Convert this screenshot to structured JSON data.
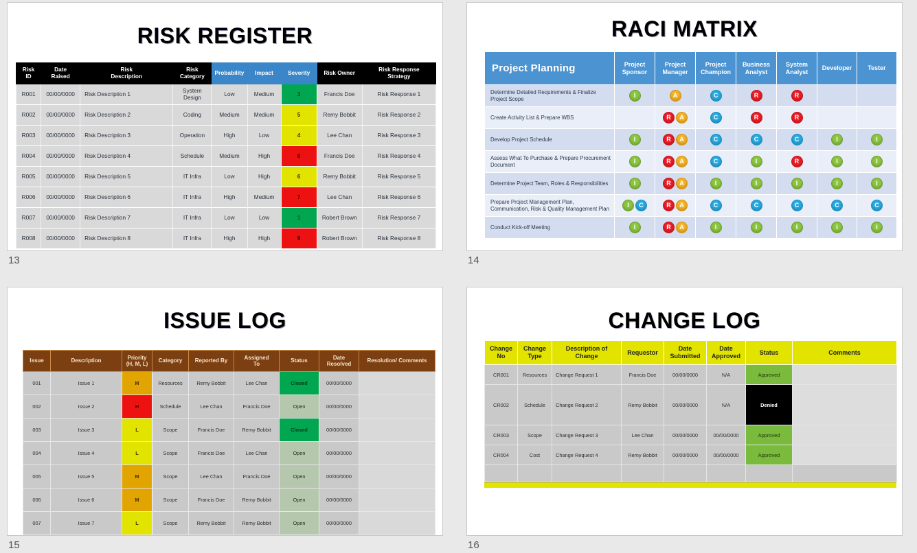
{
  "slides": [
    {
      "number": "13",
      "title": "RISK REGISTER",
      "table": {
        "headers": [
          {
            "label": "Risk ID",
            "lines": [
              "Risk",
              "ID"
            ],
            "style": "black"
          },
          {
            "label": "Date Raised",
            "lines": [
              "Date",
              "Raised"
            ],
            "style": "black"
          },
          {
            "label": "Risk Description",
            "lines": [
              "Risk",
              "Description"
            ],
            "style": "black"
          },
          {
            "label": "Risk Category",
            "lines": [
              "Risk",
              "Category"
            ],
            "style": "black"
          },
          {
            "label": "Probability",
            "lines": [
              "Probability"
            ],
            "style": "blue"
          },
          {
            "label": "Impact",
            "lines": [
              "Impact"
            ],
            "style": "blue"
          },
          {
            "label": "Severity",
            "lines": [
              "Severity"
            ],
            "style": "blue"
          },
          {
            "label": "Risk Owner",
            "lines": [
              "Risk Owner"
            ],
            "style": "black"
          },
          {
            "label": "Risk Response Strategy",
            "lines": [
              "Risk Response",
              "Strategy"
            ],
            "style": "black"
          }
        ],
        "rows": [
          {
            "id": "R001",
            "date": "00/00/0000",
            "description": "Risk Description 1",
            "category": "System Design",
            "probability": "Low",
            "impact": "Medium",
            "severity": "3",
            "severity_color": "g",
            "owner": "Francis Doe",
            "response": "Risk Response 1"
          },
          {
            "id": "R002",
            "date": "00/00/0000",
            "description": "Risk Description 2",
            "category": "Coding",
            "probability": "Medium",
            "impact": "Medium",
            "severity": "5",
            "severity_color": "y",
            "owner": "Remy Bobbit",
            "response": "Risk Response 2"
          },
          {
            "id": "R003",
            "date": "00/00/0000",
            "description": "Risk Description 3",
            "category": "Operation",
            "probability": "High",
            "impact": "Low",
            "severity": "4",
            "severity_color": "y",
            "owner": "Lee Chan",
            "response": "Risk Response 3"
          },
          {
            "id": "R004",
            "date": "00/00/0000",
            "description": "Risk Description 4",
            "category": "Schedule",
            "probability": "Medium",
            "impact": "High",
            "severity": "8",
            "severity_color": "r",
            "owner": "Francis Doe",
            "response": "Risk Response 4"
          },
          {
            "id": "R005",
            "date": "00/00/0000",
            "description": "Risk Description 5",
            "category": "IT Infra",
            "probability": "Low",
            "impact": "High",
            "severity": "6",
            "severity_color": "y",
            "owner": "Remy Bobbit",
            "response": "Risk Response 5"
          },
          {
            "id": "R006",
            "date": "00/00/0000",
            "description": "Risk Description 6",
            "category": "IT Infra",
            "probability": "High",
            "impact": "Medium",
            "severity": "7",
            "severity_color": "r",
            "owner": "Lee Chan",
            "response": "Risk Response 6"
          },
          {
            "id": "R007",
            "date": "00/00/0000",
            "description": "Risk Description 7",
            "category": "IT Infra",
            "probability": "Low",
            "impact": "Low",
            "severity": "1",
            "severity_color": "g",
            "owner": "Robert Brown",
            "response": "Risk Response 7"
          },
          {
            "id": "R008",
            "date": "00/00/0000",
            "description": "Risk Description 8",
            "category": "IT Infra",
            "probability": "High",
            "impact": "High",
            "severity": "9",
            "severity_color": "r",
            "owner": "Robert Brown",
            "response": "Risk Response 8"
          }
        ]
      }
    },
    {
      "number": "14",
      "title": "RACI MATRIX",
      "table": {
        "section_label": "Project Planning",
        "roles": [
          "Project Sponsor",
          "Project Manager",
          "Project Champion",
          "Business Analyst",
          "System Analyst",
          "Developer",
          "Tester"
        ],
        "role_lines": [
          [
            "Project",
            "Sponsor"
          ],
          [
            "Project",
            "Manager"
          ],
          [
            "Project",
            "Champion"
          ],
          [
            "Business",
            "Analyst"
          ],
          [
            "System",
            "Analyst"
          ],
          [
            "Developer"
          ],
          [
            "Tester"
          ]
        ],
        "rows": [
          {
            "task": "Determine Detailed Requirements & Finalize Project Scope",
            "cells": [
              [
                "I"
              ],
              [
                "A"
              ],
              [
                "C"
              ],
              [
                "R"
              ],
              [
                "R"
              ],
              [],
              []
            ]
          },
          {
            "task": "Create Activity List & Prepare WBS",
            "cells": [
              [],
              [
                "R",
                "A"
              ],
              [
                "C"
              ],
              [
                "R"
              ],
              [
                "R"
              ],
              [],
              []
            ]
          },
          {
            "task": "Develop Project Schedule",
            "cells": [
              [
                "I"
              ],
              [
                "R",
                "A"
              ],
              [
                "C"
              ],
              [
                "C"
              ],
              [
                "C"
              ],
              [
                "I"
              ],
              [
                "I"
              ]
            ]
          },
          {
            "task": "Assess What To Purchase & Prepare Procurement Document",
            "cells": [
              [
                "I"
              ],
              [
                "R",
                "A"
              ],
              [
                "C"
              ],
              [
                "I"
              ],
              [
                "R"
              ],
              [
                "I"
              ],
              [
                "I"
              ]
            ]
          },
          {
            "task": "Determine Project Team, Roles & Responsibilities",
            "cells": [
              [
                "I"
              ],
              [
                "R",
                "A"
              ],
              [
                "I"
              ],
              [
                "I"
              ],
              [
                "I"
              ],
              [
                "I"
              ],
              [
                "I"
              ]
            ]
          },
          {
            "task": "Prepare Project Management Plan, Communication, Risk & Quality Management Plan",
            "cells": [
              [
                "I",
                "C"
              ],
              [
                "R",
                "A"
              ],
              [
                "C"
              ],
              [
                "C"
              ],
              [
                "C"
              ],
              [
                "C"
              ],
              [
                "C"
              ]
            ]
          },
          {
            "task": "Conduct Kick-off Meeting",
            "cells": [
              [
                "I"
              ],
              [
                "R",
                "A"
              ],
              [
                "I"
              ],
              [
                "I"
              ],
              [
                "I"
              ],
              [
                "I"
              ],
              [
                "I"
              ]
            ]
          }
        ]
      }
    },
    {
      "number": "15",
      "title": "ISSUE LOG",
      "table": {
        "headers": [
          {
            "lines": [
              "Issue"
            ]
          },
          {
            "lines": [
              "Description"
            ]
          },
          {
            "lines": [
              "Priority",
              "(H, M, L)"
            ]
          },
          {
            "lines": [
              "Category"
            ]
          },
          {
            "lines": [
              "Reported By"
            ]
          },
          {
            "lines": [
              "Assigned",
              "To"
            ]
          },
          {
            "lines": [
              "Status"
            ]
          },
          {
            "lines": [
              "Date",
              "Resolved"
            ]
          },
          {
            "lines": [
              "Resolution/ Comments"
            ]
          }
        ],
        "rows": [
          {
            "issue": "001",
            "description": "Issue 1",
            "priority": "M",
            "category": "Resources",
            "reported_by": "Remy Bobbit",
            "assigned_to": "Lee Chan",
            "status": "Closed",
            "date_resolved": "00/00/0000",
            "resolution": ""
          },
          {
            "issue": "002",
            "description": "Issue 2",
            "priority": "H",
            "category": "Schedule",
            "reported_by": "Lee Chan",
            "assigned_to": "Francis Doe",
            "status": "Open",
            "date_resolved": "00/00/0000",
            "resolution": ""
          },
          {
            "issue": "003",
            "description": "Issue 3",
            "priority": "L",
            "category": "Scope",
            "reported_by": "Francis Doe",
            "assigned_to": "Remy Bobbit",
            "status": "Closed",
            "date_resolved": "00/00/0000",
            "resolution": ""
          },
          {
            "issue": "004",
            "description": "Issue 4",
            "priority": "L",
            "category": "Scope",
            "reported_by": "Francis Doe",
            "assigned_to": "Lee Chan",
            "status": "Open",
            "date_resolved": "00/00/0000",
            "resolution": ""
          },
          {
            "issue": "005",
            "description": "Issue 5",
            "priority": "M",
            "category": "Scope",
            "reported_by": "Lee Chan",
            "assigned_to": "Francis Doe",
            "status": "Open",
            "date_resolved": "00/00/0000",
            "resolution": ""
          },
          {
            "issue": "006",
            "description": "Issue 6",
            "priority": "M",
            "category": "Scope",
            "reported_by": "Francis Doe",
            "assigned_to": "Remy Bobbit",
            "status": "Open",
            "date_resolved": "00/00/0000",
            "resolution": ""
          },
          {
            "issue": "007",
            "description": "Issue 7",
            "priority": "L",
            "category": "Scope",
            "reported_by": "Remy Bobbit",
            "assigned_to": "Remy Bobbit",
            "status": "Open",
            "date_resolved": "00/00/0000",
            "resolution": ""
          }
        ]
      }
    },
    {
      "number": "16",
      "title": "CHANGE LOG",
      "table": {
        "headers": [
          {
            "lines": [
              "Change",
              "No"
            ]
          },
          {
            "lines": [
              "Change",
              "Type"
            ]
          },
          {
            "lines": [
              "Description of",
              "Change"
            ]
          },
          {
            "lines": [
              "Requestor"
            ]
          },
          {
            "lines": [
              "Date",
              "Submitted"
            ]
          },
          {
            "lines": [
              "Date",
              "Approved"
            ]
          },
          {
            "lines": [
              "Status"
            ]
          },
          {
            "lines": [
              "Comments"
            ]
          }
        ],
        "rows": [
          {
            "no": "CR001",
            "type": "Resources",
            "description": "Change Request 1",
            "requestor": "Francis Doe",
            "date_submitted": "00/00/0000",
            "date_approved": "N/A",
            "status": "Approved",
            "comments": "",
            "tall": false
          },
          {
            "no": "CR002",
            "type": "Schedule",
            "description": "Change Request 2",
            "requestor": "Remy Bobbit",
            "date_submitted": "00/00/0000",
            "date_approved": "N/A",
            "status": "Denied",
            "comments": "",
            "tall": true
          },
          {
            "no": "CR003",
            "type": "Scope",
            "description": "Change Request 3",
            "requestor": "Lee Chan",
            "date_submitted": "00/00/0000",
            "date_approved": "00/00/0000",
            "status": "Approved",
            "comments": "",
            "tall": false
          },
          {
            "no": "CR004",
            "type": "Cost",
            "description": "Change Request 4",
            "requestor": "Remy Bobbit",
            "date_submitted": "00/00/0000",
            "date_approved": "00/00/0000",
            "status": "Approved",
            "comments": "",
            "tall": false
          },
          {
            "no": "",
            "type": "",
            "description": "",
            "requestor": "",
            "date_submitted": "",
            "date_approved": "",
            "status": "",
            "comments": "",
            "tall": false,
            "blank": true
          }
        ]
      }
    }
  ],
  "colors": {
    "black_header": "#000000",
    "blue_header": "#3a86c8",
    "raci_blue": "#4b93d1",
    "issue_brown": "#7c3f12",
    "change_yellow": "#e3e300",
    "severity_green": "#00a650",
    "severity_yellow": "#e3e300",
    "severity_red": "#ee1111",
    "approved_green": "#7aba3c",
    "denied_black": "#000000"
  }
}
